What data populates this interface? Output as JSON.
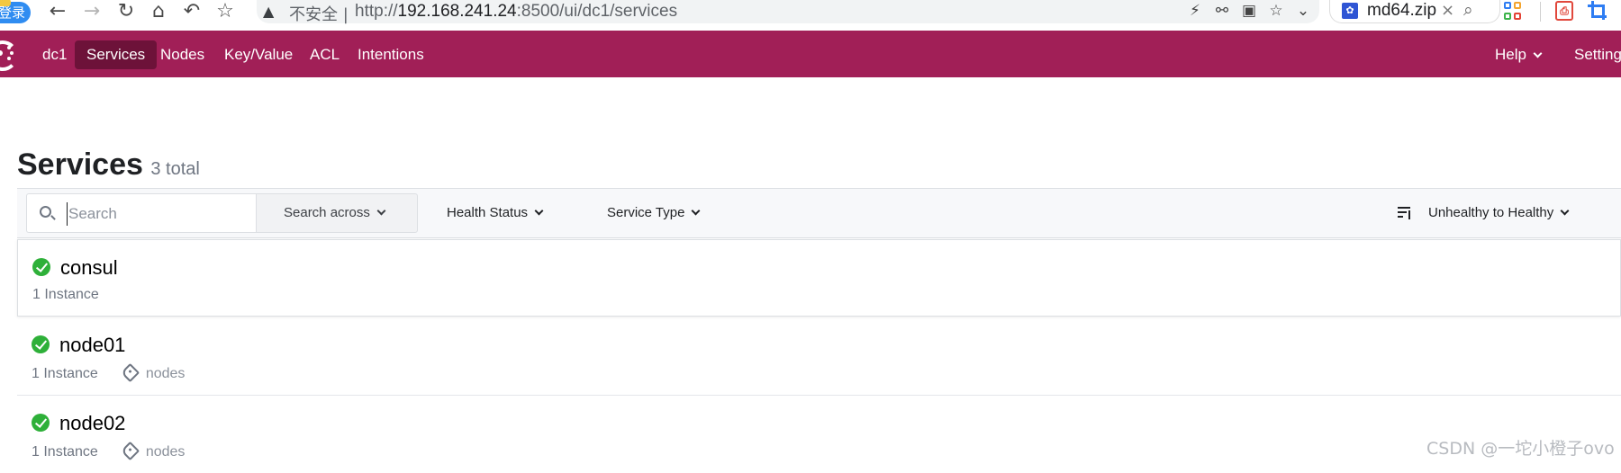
{
  "browser": {
    "login_badge": "登录",
    "back_icon": "←",
    "forward_icon": "→",
    "reload_icon": "↻",
    "home_icon": "⌂",
    "undo_icon": "↶",
    "star_icon": "☆",
    "security_label": "不安全",
    "url_prefix": "http://",
    "url_host": "192.168.241.24",
    "url_rest": ":8500/ui/dc1/services",
    "tools": [
      "⚡",
      "⚯",
      "▣",
      "☆",
      "⌄"
    ],
    "side_tab_label": "md64.zip",
    "side_tab_close": "×",
    "side_tab_search": "⌕",
    "pdf_label": "⎙"
  },
  "nav": {
    "datacenter": "dc1",
    "items": [
      {
        "label": "Services"
      },
      {
        "label": "Nodes"
      },
      {
        "label": "Key/Value"
      },
      {
        "label": "ACL"
      },
      {
        "label": "Intentions"
      }
    ],
    "help_label": "Help",
    "settings_label": "Settings",
    "accent_color": "#a11f57",
    "active_color": "#6d1239"
  },
  "page": {
    "title": "Services",
    "count": "3 total"
  },
  "filters": {
    "search_placeholder": "Search",
    "search_value": "",
    "search_across": "Search across",
    "health_status": "Health Status",
    "service_type": "Service Type",
    "sort": "Unhealthy to Healthy"
  },
  "services": [
    {
      "name": "consul",
      "instances": "1 Instance",
      "tag": "",
      "status": "passing"
    },
    {
      "name": "node01",
      "instances": "1 Instance",
      "tag": "nodes",
      "status": "passing"
    },
    {
      "name": "node02",
      "instances": "1 Instance",
      "tag": "nodes",
      "status": "passing"
    }
  ],
  "watermark": "CSDN @一坨小橙子ovo"
}
